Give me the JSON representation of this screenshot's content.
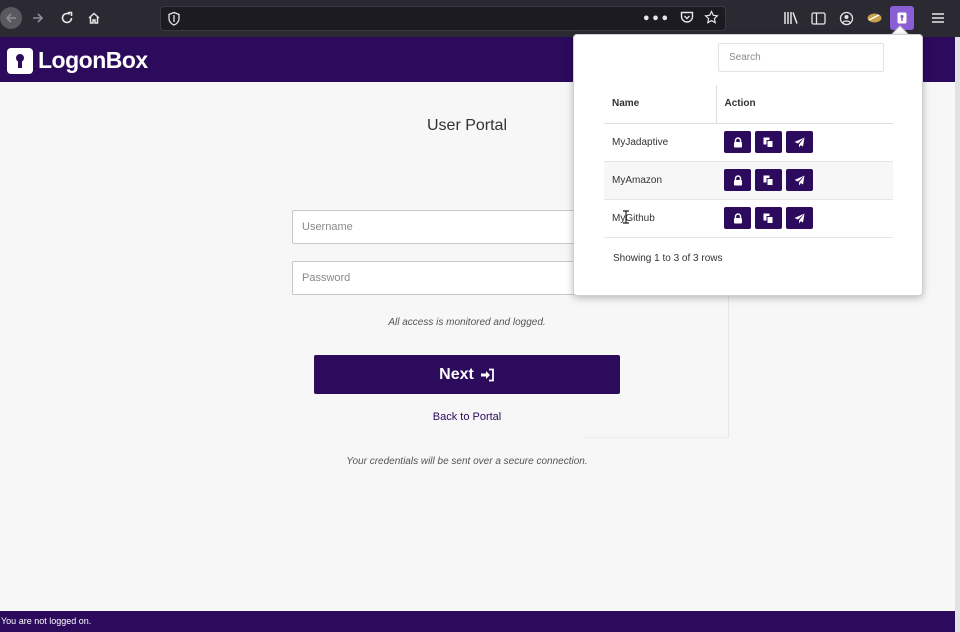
{
  "browser": {
    "url": "",
    "icons": {
      "back": "arrow-left-icon",
      "forward": "arrow-right-icon",
      "reload": "reload-icon",
      "home": "home-icon",
      "shield": "shield-icon",
      "more": "more-horizontal-icon",
      "pocket": "pocket-icon",
      "bookmark": "star-icon",
      "library": "library-icon",
      "sidebar": "sidebar-icon",
      "account": "account-icon",
      "extension": "extension-icon",
      "logonbox_extension": "keyhole-icon",
      "menu": "hamburger-menu-icon"
    }
  },
  "header": {
    "logo_text": "LogonBox",
    "color": "#2c0a5c"
  },
  "main": {
    "title": "User Portal",
    "username_placeholder": "Username",
    "password_placeholder": "Password",
    "monitored_text": "All access is monitored and logged.",
    "next_label": "Next",
    "back_link": "Back to Portal",
    "secure_text": "Your credentials will be sent over a secure connection."
  },
  "footer": {
    "status": "You are not logged on."
  },
  "popup": {
    "search_placeholder": "Search",
    "columns": [
      "Name",
      "Action"
    ],
    "rows": [
      {
        "name": "MyJadaptive"
      },
      {
        "name": "MyAmazon"
      },
      {
        "name": "MyGithub"
      }
    ],
    "action_icons": [
      "lock-icon",
      "copy-icon",
      "send-icon"
    ],
    "summary": "Showing 1 to 3 of 3 rows"
  },
  "colors": {
    "brand": "#2c0a5c",
    "browser_chrome": "#2b2a33",
    "extension_accent": "#8a5fd6"
  }
}
